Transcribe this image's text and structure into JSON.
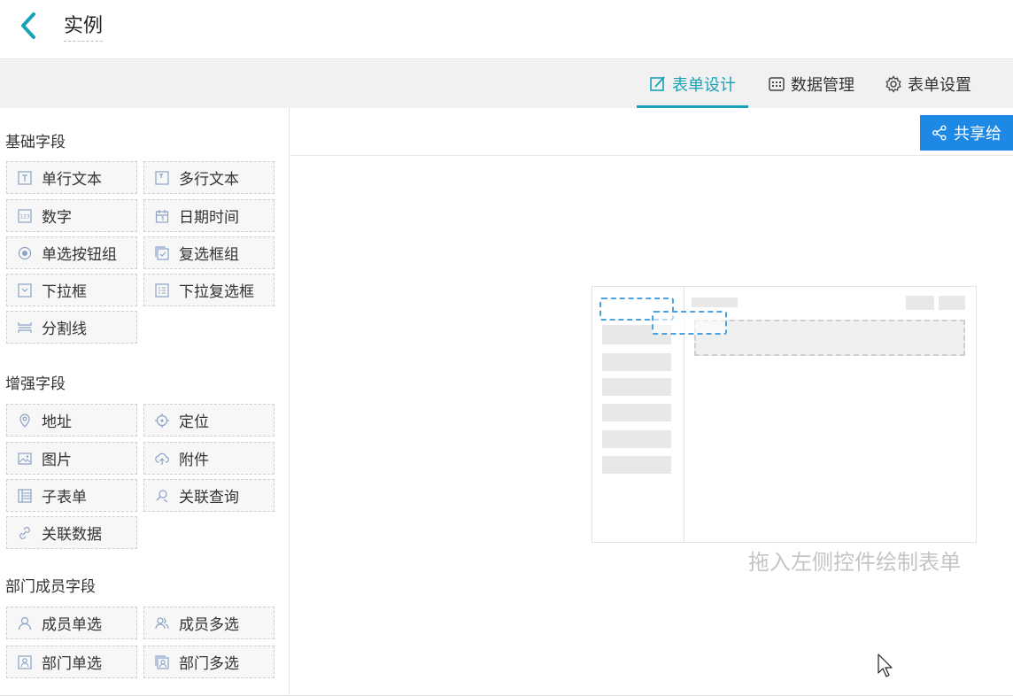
{
  "header": {
    "title": "实例"
  },
  "tabs": [
    {
      "label": "表单设计",
      "icon": "edit-icon",
      "active": true
    },
    {
      "label": "数据管理",
      "icon": "grid-icon",
      "active": false
    },
    {
      "label": "表单设置",
      "icon": "gear-icon",
      "active": false
    }
  ],
  "accent_color": "#17a2b8",
  "share_button": {
    "label": "共享给",
    "color": "#1e88e5"
  },
  "sections": [
    {
      "title": "基础字段",
      "fields": [
        {
          "label": "单行文本",
          "icon": "single-line-text-icon"
        },
        {
          "label": "多行文本",
          "icon": "multi-line-text-icon"
        },
        {
          "label": "数字",
          "icon": "number-icon"
        },
        {
          "label": "日期时间",
          "icon": "calendar-icon"
        },
        {
          "label": "单选按钮组",
          "icon": "radio-icon"
        },
        {
          "label": "复选框组",
          "icon": "checkbox-icon"
        },
        {
          "label": "下拉框",
          "icon": "dropdown-icon"
        },
        {
          "label": "下拉复选框",
          "icon": "dropdown-checklist-icon"
        },
        {
          "label": "分割线",
          "icon": "divider-icon"
        }
      ]
    },
    {
      "title": "增强字段",
      "fields": [
        {
          "label": "地址",
          "icon": "location-pin-icon"
        },
        {
          "label": "定位",
          "icon": "crosshair-icon"
        },
        {
          "label": "图片",
          "icon": "image-icon"
        },
        {
          "label": "附件",
          "icon": "upload-cloud-icon"
        },
        {
          "label": "子表单",
          "icon": "subform-icon"
        },
        {
          "label": "关联查询",
          "icon": "link-query-icon"
        },
        {
          "label": "关联数据",
          "icon": "link-data-icon"
        }
      ]
    },
    {
      "title": "部门成员字段",
      "fields": [
        {
          "label": "成员单选",
          "icon": "user-icon"
        },
        {
          "label": "成员多选",
          "icon": "users-icon"
        },
        {
          "label": "部门单选",
          "icon": "department-icon"
        },
        {
          "label": "部门多选",
          "icon": "departments-icon"
        }
      ]
    }
  ],
  "canvas": {
    "hint": "拖入左侧控件绘制表单"
  }
}
